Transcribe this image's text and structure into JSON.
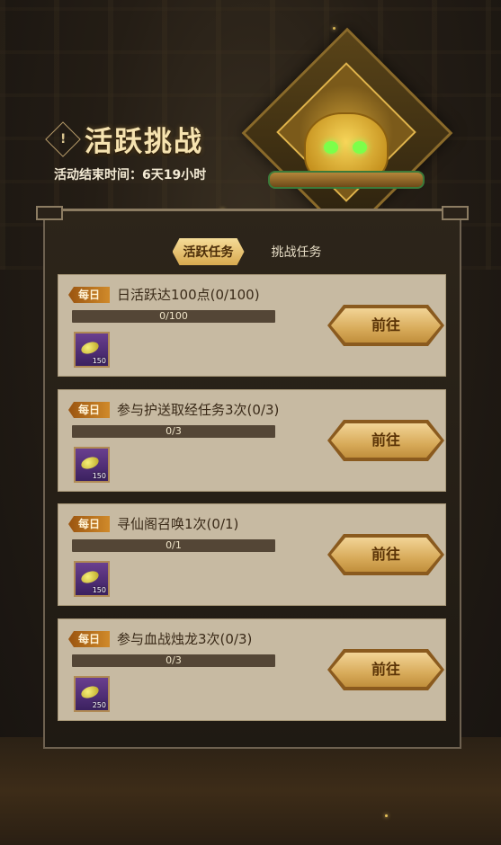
{
  "header": {
    "title": "活跃挑战",
    "countdown_label": "活动结束时间：6天19小时",
    "info_glyph": "!"
  },
  "tabs": [
    {
      "label": "活跃任务",
      "active": true
    },
    {
      "label": "挑战任务",
      "active": false
    }
  ],
  "tasks": [
    {
      "badge": "每日",
      "title": "日活跃达100点(0/100)",
      "progress_text": "0/100",
      "progress": 0,
      "reward_qty": "150",
      "button": "前往"
    },
    {
      "badge": "每日",
      "title": "参与护送取经任务3次(0/3)",
      "progress_text": "0/3",
      "progress": 0,
      "reward_qty": "150",
      "button": "前往"
    },
    {
      "badge": "每日",
      "title": "寻仙阁召唤1次(0/1)",
      "progress_text": "0/1",
      "progress": 0,
      "reward_qty": "150",
      "button": "前往"
    },
    {
      "badge": "每日",
      "title": "参与血战烛龙3次(0/3)",
      "progress_text": "0/3",
      "progress": 0,
      "reward_qty": "250",
      "button": "前往"
    }
  ],
  "colors": {
    "accent_gold": "#d8ab5a",
    "panel_bg": "#1f1a13",
    "card_bg": "#c7baa2",
    "badge_orange": "#c07a20"
  },
  "icons": {
    "reward": "gold-ingot-icon",
    "emblem": "golden-beast-emblem"
  }
}
